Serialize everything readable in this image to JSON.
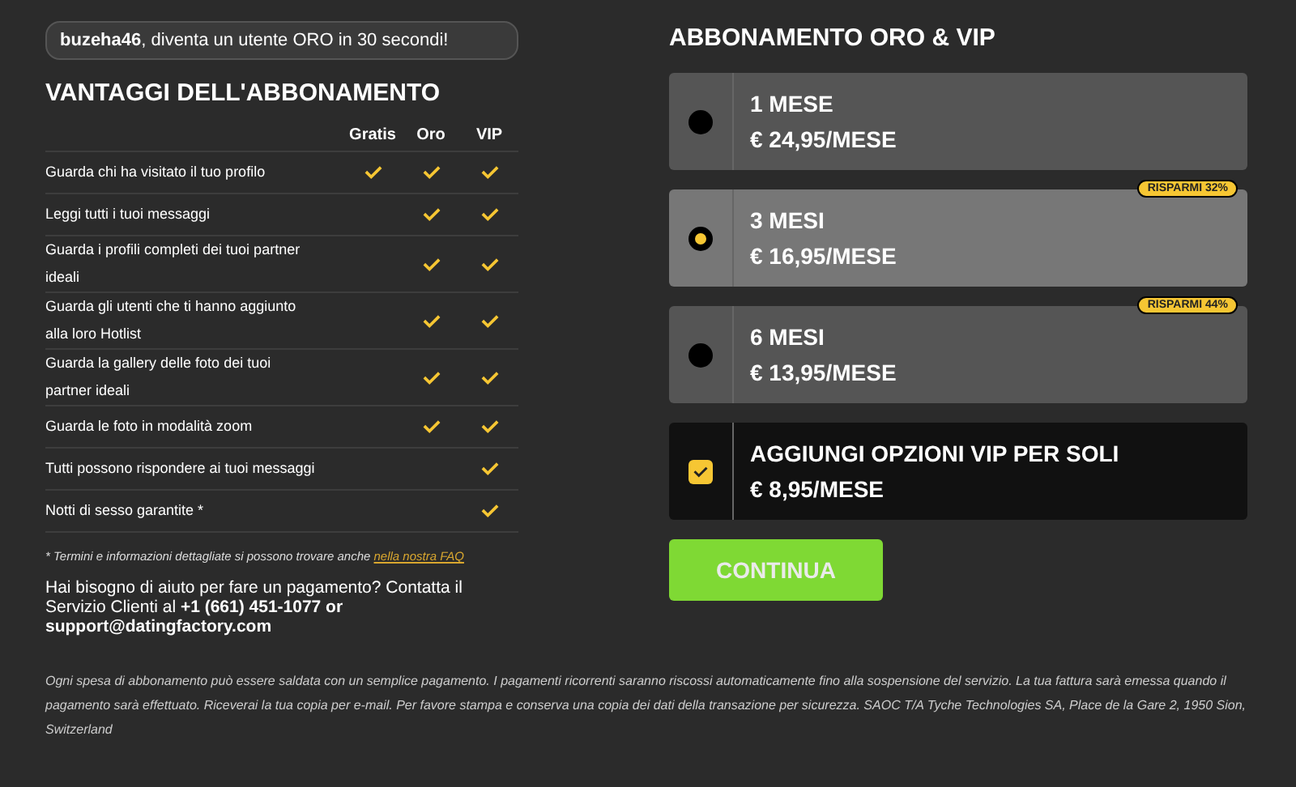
{
  "banner": {
    "text": "**buzeha46**, diventa un utente ORO in 30 secondi!"
  },
  "benefits": {
    "title": "VANTAGGI DELL'ABBONAMENTO",
    "columns": [
      "Gratis",
      "Oro",
      "VIP"
    ],
    "rows": [
      {
        "label": "Guarda chi ha visitato il tuo profilo",
        "included": [
          true,
          true,
          true
        ]
      },
      {
        "label": "Leggi tutti i tuoi messaggi",
        "included": [
          false,
          true,
          true
        ]
      },
      {
        "label": "Guarda i profili completi dei tuoi partner ideali",
        "included": [
          false,
          true,
          true
        ]
      },
      {
        "label": "Guarda gli utenti che ti hanno aggiunto alla loro Hotlist",
        "included": [
          false,
          true,
          true
        ]
      },
      {
        "label": "Guarda la gallery delle foto dei tuoi partner ideali",
        "included": [
          false,
          true,
          true
        ]
      },
      {
        "label": "Guarda le foto in modalità zoom",
        "included": [
          false,
          true,
          true
        ]
      },
      {
        "label": "Tutti possono rispondere ai tuoi messaggi",
        "included": [
          false,
          false,
          true
        ]
      },
      {
        "label": "Notti di sesso garantite *",
        "included": [
          false,
          false,
          true
        ]
      }
    ],
    "footnote": "* Termini e informazioni dettagliate si possono trovare anche ",
    "footnote_link": "nella nostra FAQ",
    "help": "Hai bisogno di aiuto per fare un pagamento? Contatta il Servizio Clienti al **+1 (661) 451-1077 or support@datingfactory.com**"
  },
  "subscription": {
    "title": "ABBONAMENTO ORO & VIP",
    "plans": [
      {
        "name": "1 MESE",
        "price": "€ 24,95/MESE",
        "selected": false
      },
      {
        "name": "3 MESI",
        "price": "€ 16,95/MESE",
        "selected": true,
        "badge": "RISPARMI 32%"
      },
      {
        "name": "6 MESI",
        "price": "€ 13,95/MESE",
        "selected": false,
        "badge": "RISPARMI 44%"
      }
    ],
    "vip_option": {
      "label": "AGGIUNGI OPZIONI VIP PER SOLI",
      "price": "€ 8,95/MESE",
      "checked": true
    },
    "button": "CONTINUA"
  },
  "footer": "Ogni spesa di abbonamento può essere saldata con un semplice pagamento. I pagamenti ricorrenti saranno riscossi automaticamente fino alla sospensione del servizio. La tua fattura sarà emessa quando il pagamento sarà effettuato. Riceverai la tua copia per e-mail. Per favore stampa e conserva una copia dei dati della transazione per sicurezza. SAOC T/A Tyche Technologies SA, Place de la Gare 2, 1950 Sion, Switzerland"
}
